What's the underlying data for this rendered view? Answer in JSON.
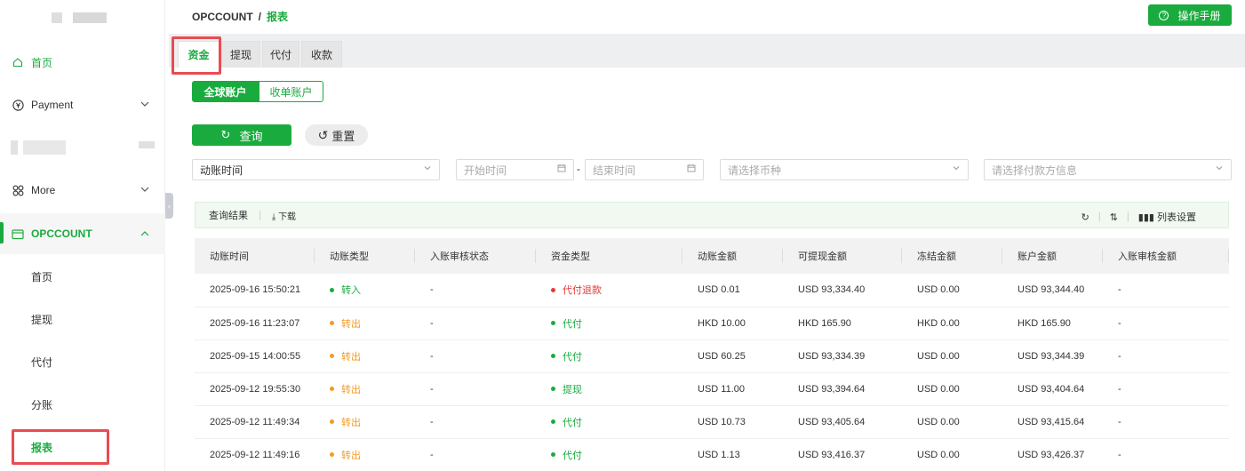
{
  "sidebar": {
    "items": [
      {
        "label": "首页",
        "icon": "home-icon"
      },
      {
        "label": "Payment",
        "icon": "yen-circle-icon"
      },
      {
        "label": "More",
        "icon": "grid-icon"
      },
      {
        "label": "OPCCOUNT",
        "icon": "wallet-icon"
      }
    ],
    "sub_items": [
      "首页",
      "提现",
      "代付",
      "分账",
      "报表"
    ]
  },
  "breadcrumb": {
    "root": "OPCCOUNT",
    "separator": "/",
    "current": "报表"
  },
  "header": {
    "manual_button": "操作手册"
  },
  "tabs": [
    "资金",
    "提现",
    "代付",
    "收款"
  ],
  "account_switch": [
    "全球账户",
    "收单账户"
  ],
  "actions": {
    "query": "查询",
    "reset": "重置"
  },
  "filters": {
    "time_type": "动账时间",
    "start_placeholder": "开始时间",
    "range_dash": "-",
    "end_placeholder": "结束时间",
    "currency_placeholder": "请选择币种",
    "payee_placeholder": "请选择付款方信息"
  },
  "result_bar": {
    "title": "查询结果",
    "download": "下载",
    "column_settings": "列表设置"
  },
  "table": {
    "columns": [
      "动账时间",
      "动账类型",
      "入账审核状态",
      "资金类型",
      "动账金额",
      "可提现金额",
      "冻结金额",
      "账户金额",
      "入账审核金额"
    ],
    "rows": [
      {
        "time": "2025-09-16 15:50:21",
        "type": "转入",
        "type_color": "#1aab3f",
        "audit": "-",
        "fund": "代付退款",
        "fund_color": "#e53935",
        "amount": "USD 0.01",
        "withdrawable": "USD 93,334.40",
        "frozen": "USD 0.00",
        "balance": "USD 93,344.40",
        "audit_amount": "-"
      },
      {
        "time": "2025-09-16 11:23:07",
        "type": "转出",
        "type_color": "#f59a23",
        "audit": "-",
        "fund": "代付",
        "fund_color": "#1aab3f",
        "amount": "HKD 10.00",
        "withdrawable": "HKD 165.90",
        "frozen": "HKD 0.00",
        "balance": "HKD 165.90",
        "audit_amount": "-"
      },
      {
        "time": "2025-09-15 14:00:55",
        "type": "转出",
        "type_color": "#f59a23",
        "audit": "-",
        "fund": "代付",
        "fund_color": "#1aab3f",
        "amount": "USD 60.25",
        "withdrawable": "USD 93,334.39",
        "frozen": "USD 0.00",
        "balance": "USD 93,344.39",
        "audit_amount": "-"
      },
      {
        "time": "2025-09-12 19:55:30",
        "type": "转出",
        "type_color": "#f59a23",
        "audit": "-",
        "fund": "提现",
        "fund_color": "#1aab3f",
        "amount": "USD 11.00",
        "withdrawable": "USD 93,394.64",
        "frozen": "USD 0.00",
        "balance": "USD 93,404.64",
        "audit_amount": "-"
      },
      {
        "time": "2025-09-12 11:49:34",
        "type": "转出",
        "type_color": "#f59a23",
        "audit": "-",
        "fund": "代付",
        "fund_color": "#1aab3f",
        "amount": "USD 10.73",
        "withdrawable": "USD 93,405.64",
        "frozen": "USD 0.00",
        "balance": "USD 93,415.64",
        "audit_amount": "-"
      },
      {
        "time": "2025-09-12 11:49:16",
        "type": "转出",
        "type_color": "#f59a23",
        "audit": "-",
        "fund": "代付",
        "fund_color": "#1aab3f",
        "amount": "USD 1.13",
        "withdrawable": "USD 93,416.37",
        "frozen": "USD 0.00",
        "balance": "USD 93,426.37",
        "audit_amount": "-"
      }
    ]
  },
  "colors": {
    "accent": "#1aab3f",
    "highlight": "#e94b52",
    "warning": "#f59a23",
    "danger": "#e53935"
  }
}
